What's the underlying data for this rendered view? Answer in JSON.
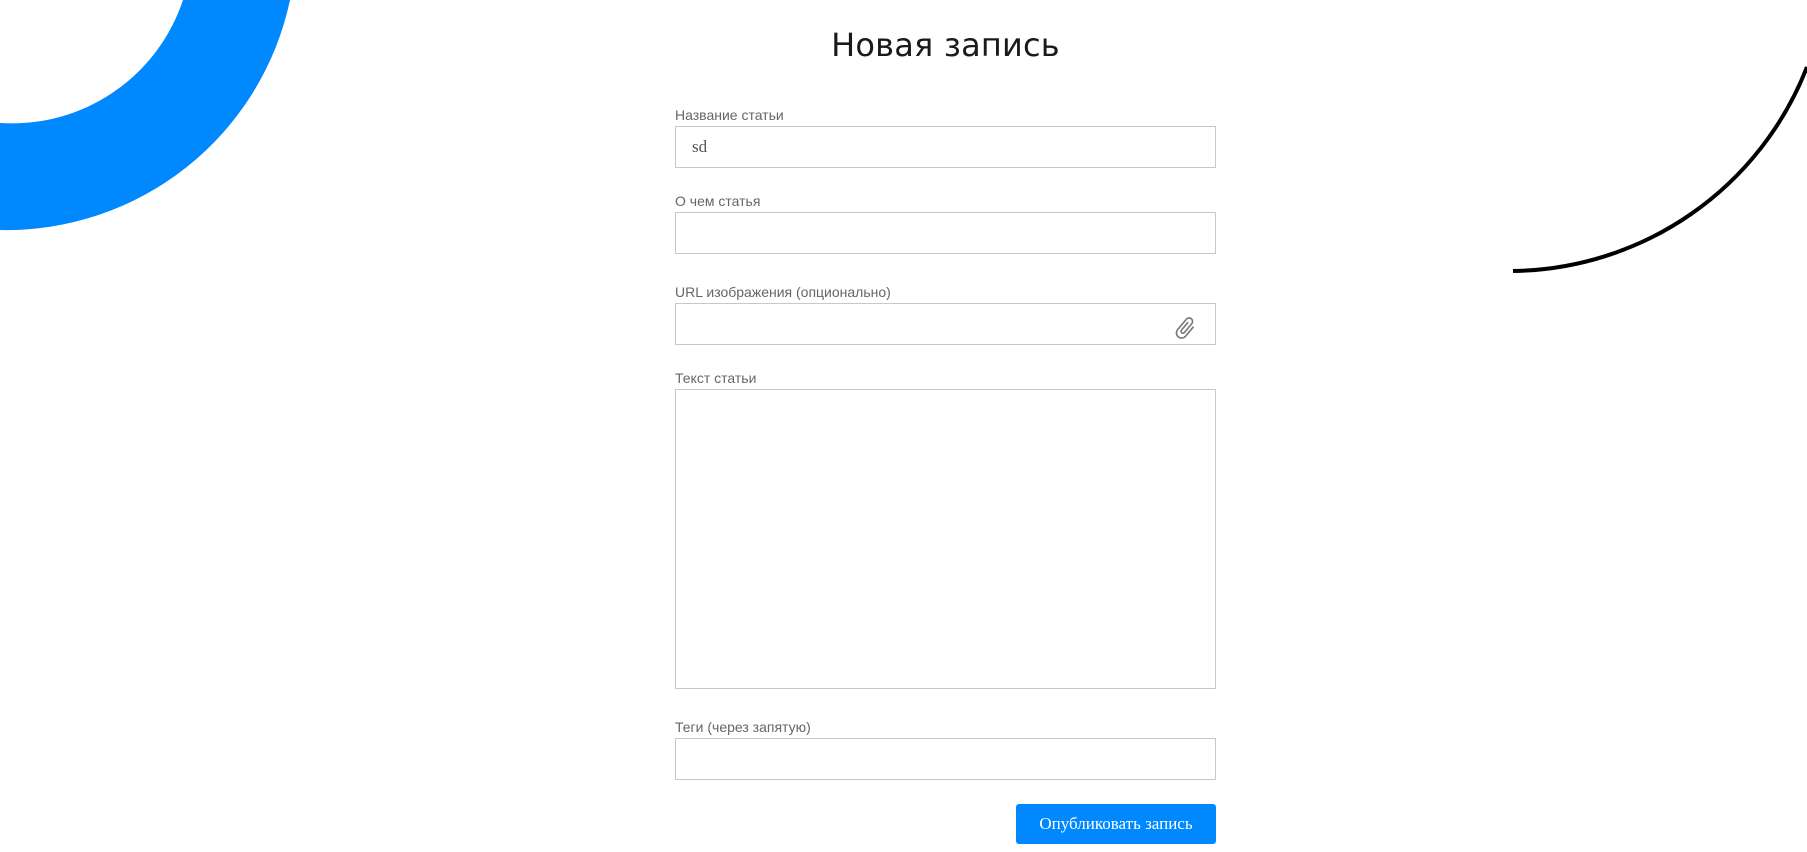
{
  "page": {
    "title": "Новая запись"
  },
  "form": {
    "title_field": {
      "label": "Название статьи",
      "value": "sd",
      "placeholder": ""
    },
    "about_field": {
      "label": "О чем статья",
      "value": "",
      "placeholder": ""
    },
    "image_url_field": {
      "label": "URL изображения (опционально)",
      "value": "",
      "placeholder": "",
      "icon": "paperclip-icon"
    },
    "body_field": {
      "label": "Текст статьи",
      "value": "",
      "placeholder": ""
    },
    "tags_field": {
      "label": "Теги (через запятую)",
      "value": "",
      "placeholder": ""
    },
    "publish_label": "Опубликовать запись"
  },
  "colors": {
    "accent": "#0088ff",
    "decor_line": "#000000",
    "border": "#c8c8c8",
    "label": "#666666"
  }
}
